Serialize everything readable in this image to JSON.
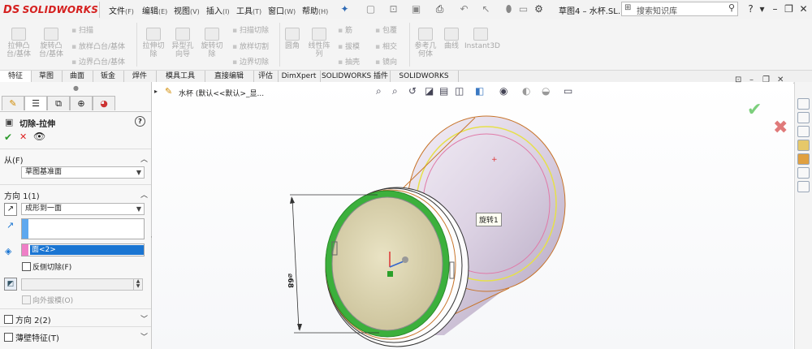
{
  "app": {
    "brand": "SOLIDWORKS",
    "brand_prefix": "DS"
  },
  "menu": [
    {
      "label": "文件",
      "key": "(F)"
    },
    {
      "label": "编辑",
      "key": "(E)"
    },
    {
      "label": "视图",
      "key": "(V)"
    },
    {
      "label": "插入",
      "key": "(I)"
    },
    {
      "label": "工具",
      "key": "(T)"
    },
    {
      "label": "窗口",
      "key": "(W)"
    },
    {
      "label": "帮助",
      "key": "(H)"
    }
  ],
  "doc_title": "草图4 – 水杯.SL...",
  "search": {
    "placeholder": "搜索知识库"
  },
  "toolbar": {
    "extrude_boss": "拉伸凸\n台/基体",
    "revolve_boss": "旋转凸\n台/基体",
    "sweep": "扫描",
    "loft": "放样凸台/基体",
    "boundary_boss": "边界凸台/基体",
    "extrude_cut": "拉伸切\n除",
    "hole_wizard": "异型孔\n向导",
    "revolve_cut": "旋转切\n除",
    "swept_cut": "扫描切除",
    "lofted_cut": "放样切割",
    "boundary_cut": "边界切除",
    "fillet": "圆角",
    "linear_pattern": "线性阵\n列",
    "rib": "筋",
    "draft": "拔模",
    "shell": "抽壳",
    "wrap": "包覆",
    "intersect": "相交",
    "mirror": "镜向",
    "ref_geometry": "参考几\n何体",
    "curves": "曲线",
    "instant3d": "Instant3D"
  },
  "tabs": [
    "特征",
    "草图",
    "曲面",
    "钣金",
    "焊件",
    "模具工具",
    "直接编辑",
    "评估",
    "DimXpert",
    "SOLIDWORKS 插件",
    "SOLIDWORKS MBD"
  ],
  "active_tab": 0,
  "property_manager": {
    "title": "切除-拉伸",
    "help_label": "?",
    "from": {
      "header": "从(F)",
      "value": "草图基准面"
    },
    "direction1": {
      "header": "方向 1(1)",
      "end_condition": "成形到一面",
      "face_value": "面<2>",
      "flip_side_label": "反侧切除(F)",
      "draft_outward_label": "向外拔模(O)"
    },
    "direction2": {
      "header": "方向 2(2)"
    },
    "thin_feature": {
      "header": "薄壁特征(T)"
    }
  },
  "viewport": {
    "tree_node": "水杯  (默认<<默认>_显...",
    "tooltip": "旋转1",
    "dimension": "⌀68"
  },
  "colors": {
    "accent_red": "#d5201f",
    "highlight_blue": "#1a75d2",
    "model_edge": "#c8742a",
    "selected_face": "#3fb23f"
  }
}
